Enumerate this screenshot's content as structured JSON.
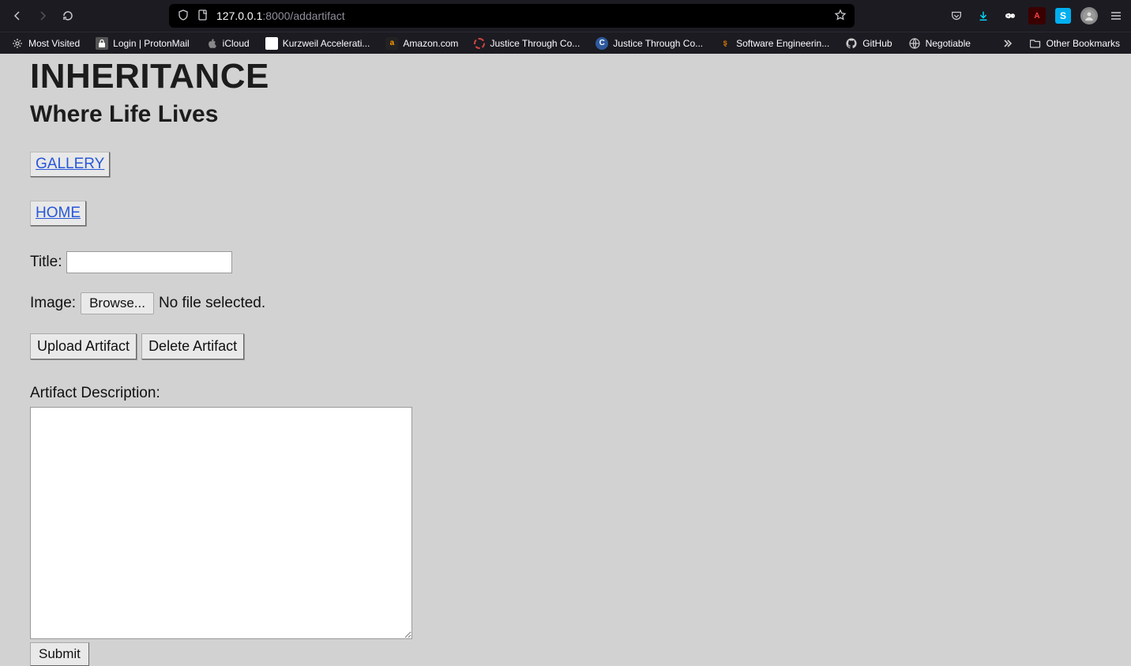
{
  "browser": {
    "url_host": "127.0.0.1",
    "url_port_path": ":8000/addartifact"
  },
  "bookmarks": [
    {
      "label": "Most Visited",
      "icon": "star"
    },
    {
      "label": "Login | ProtonMail",
      "icon": "lock"
    },
    {
      "label": "iCloud",
      "icon": "apple"
    },
    {
      "label": "Kurzweil Accelerati...",
      "icon": "white"
    },
    {
      "label": "Amazon.com",
      "icon": "amazon"
    },
    {
      "label": "Justice Through Co...",
      "icon": "red-circle"
    },
    {
      "label": "Justice Through Co...",
      "icon": "blue-c"
    },
    {
      "label": "Software Engineerin...",
      "icon": "orange-s"
    },
    {
      "label": "GitHub",
      "icon": "github"
    },
    {
      "label": "Negotiable",
      "icon": "globe"
    }
  ],
  "other_bookmarks_label": "Other Bookmarks",
  "page": {
    "heading": "INHERITANCE",
    "subheading": "Where Life Lives",
    "nav_links": {
      "gallery": "GALLERY",
      "home": "HOME"
    },
    "form": {
      "title_label": "Title:",
      "image_label": "Image:",
      "browse_label": "Browse...",
      "file_status": "No file selected.",
      "upload_button": "Upload Artifact",
      "delete_button": "Delete Artifact",
      "description_label": "Artifact Description:",
      "submit_label": "Submit"
    }
  },
  "toolbar_icons": {
    "pdf": "A",
    "skype": "S",
    "amazon_glyph": "a"
  }
}
